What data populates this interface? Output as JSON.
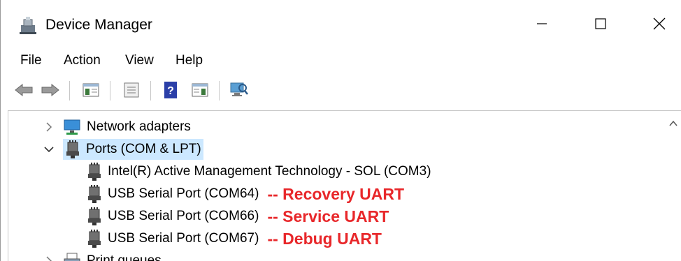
{
  "window": {
    "title": "Device Manager",
    "controls": {
      "minimize_icon": "minimize-icon",
      "maximize_icon": "maximize-icon",
      "close_icon": "close-icon"
    }
  },
  "menu": [
    {
      "label": "File"
    },
    {
      "label": "Action"
    },
    {
      "label": "View"
    },
    {
      "label": "Help"
    }
  ],
  "toolbar": {
    "buttons": [
      "back-arrow-icon",
      "forward-arrow-icon",
      "show-hide-console-tree-icon",
      "properties-icon",
      "help-icon",
      "action-pane-icon",
      "monitor-scan-icon"
    ]
  },
  "tree": {
    "network_adapters": "Network adapters",
    "ports": "Ports (COM & LPT)",
    "children": [
      {
        "label": "Intel(R) Active Management Technology - SOL (COM3)",
        "annotation": ""
      },
      {
        "label": "USB Serial Port (COM64)",
        "annotation": "-- Recovery UART"
      },
      {
        "label": "USB Serial Port (COM66)",
        "annotation": "-- Service UART"
      },
      {
        "label": "USB Serial Port (COM67)",
        "annotation": "-- Debug UART"
      }
    ],
    "print_queues": "Print queues"
  },
  "colors": {
    "selection": "#cce8ff",
    "annotation": "#e8272a"
  }
}
